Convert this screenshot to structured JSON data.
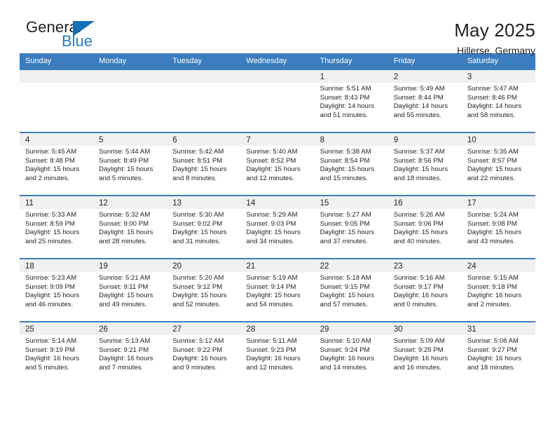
{
  "brand": {
    "name_part1": "General",
    "name_part2": "Blue",
    "triangle_color": "#1470b8",
    "blue_color": "#1f7dc0"
  },
  "header": {
    "title": "May 2025",
    "subtitle": "Hillerse, Germany"
  },
  "theme": {
    "header_row_bg": "#3b7dbf",
    "day_band_bg": "#f0f0f0",
    "text_color": "#231f20"
  },
  "weekdays": [
    "Sunday",
    "Monday",
    "Tuesday",
    "Wednesday",
    "Thursday",
    "Friday",
    "Saturday"
  ],
  "weeks": [
    [
      {
        "day": "",
        "sunrise": "",
        "sunset": "",
        "daylight_line1": "",
        "daylight_line2": ""
      },
      {
        "day": "",
        "sunrise": "",
        "sunset": "",
        "daylight_line1": "",
        "daylight_line2": ""
      },
      {
        "day": "",
        "sunrise": "",
        "sunset": "",
        "daylight_line1": "",
        "daylight_line2": ""
      },
      {
        "day": "",
        "sunrise": "",
        "sunset": "",
        "daylight_line1": "",
        "daylight_line2": ""
      },
      {
        "day": "1",
        "sunrise": "Sunrise: 5:51 AM",
        "sunset": "Sunset: 8:43 PM",
        "daylight_line1": "Daylight: 14 hours",
        "daylight_line2": "and 51 minutes."
      },
      {
        "day": "2",
        "sunrise": "Sunrise: 5:49 AM",
        "sunset": "Sunset: 8:44 PM",
        "daylight_line1": "Daylight: 14 hours",
        "daylight_line2": "and 55 minutes."
      },
      {
        "day": "3",
        "sunrise": "Sunrise: 5:47 AM",
        "sunset": "Sunset: 8:46 PM",
        "daylight_line1": "Daylight: 14 hours",
        "daylight_line2": "and 58 minutes."
      }
    ],
    [
      {
        "day": "4",
        "sunrise": "Sunrise: 5:45 AM",
        "sunset": "Sunset: 8:48 PM",
        "daylight_line1": "Daylight: 15 hours",
        "daylight_line2": "and 2 minutes."
      },
      {
        "day": "5",
        "sunrise": "Sunrise: 5:44 AM",
        "sunset": "Sunset: 8:49 PM",
        "daylight_line1": "Daylight: 15 hours",
        "daylight_line2": "and 5 minutes."
      },
      {
        "day": "6",
        "sunrise": "Sunrise: 5:42 AM",
        "sunset": "Sunset: 8:51 PM",
        "daylight_line1": "Daylight: 15 hours",
        "daylight_line2": "and 8 minutes."
      },
      {
        "day": "7",
        "sunrise": "Sunrise: 5:40 AM",
        "sunset": "Sunset: 8:52 PM",
        "daylight_line1": "Daylight: 15 hours",
        "daylight_line2": "and 12 minutes."
      },
      {
        "day": "8",
        "sunrise": "Sunrise: 5:38 AM",
        "sunset": "Sunset: 8:54 PM",
        "daylight_line1": "Daylight: 15 hours",
        "daylight_line2": "and 15 minutes."
      },
      {
        "day": "9",
        "sunrise": "Sunrise: 5:37 AM",
        "sunset": "Sunset: 8:56 PM",
        "daylight_line1": "Daylight: 15 hours",
        "daylight_line2": "and 18 minutes."
      },
      {
        "day": "10",
        "sunrise": "Sunrise: 5:35 AM",
        "sunset": "Sunset: 8:57 PM",
        "daylight_line1": "Daylight: 15 hours",
        "daylight_line2": "and 22 minutes."
      }
    ],
    [
      {
        "day": "11",
        "sunrise": "Sunrise: 5:33 AM",
        "sunset": "Sunset: 8:59 PM",
        "daylight_line1": "Daylight: 15 hours",
        "daylight_line2": "and 25 minutes."
      },
      {
        "day": "12",
        "sunrise": "Sunrise: 5:32 AM",
        "sunset": "Sunset: 9:00 PM",
        "daylight_line1": "Daylight: 15 hours",
        "daylight_line2": "and 28 minutes."
      },
      {
        "day": "13",
        "sunrise": "Sunrise: 5:30 AM",
        "sunset": "Sunset: 9:02 PM",
        "daylight_line1": "Daylight: 15 hours",
        "daylight_line2": "and 31 minutes."
      },
      {
        "day": "14",
        "sunrise": "Sunrise: 5:29 AM",
        "sunset": "Sunset: 9:03 PM",
        "daylight_line1": "Daylight: 15 hours",
        "daylight_line2": "and 34 minutes."
      },
      {
        "day": "15",
        "sunrise": "Sunrise: 5:27 AM",
        "sunset": "Sunset: 9:05 PM",
        "daylight_line1": "Daylight: 15 hours",
        "daylight_line2": "and 37 minutes."
      },
      {
        "day": "16",
        "sunrise": "Sunrise: 5:26 AM",
        "sunset": "Sunset: 9:06 PM",
        "daylight_line1": "Daylight: 15 hours",
        "daylight_line2": "and 40 minutes."
      },
      {
        "day": "17",
        "sunrise": "Sunrise: 5:24 AM",
        "sunset": "Sunset: 9:08 PM",
        "daylight_line1": "Daylight: 15 hours",
        "daylight_line2": "and 43 minutes."
      }
    ],
    [
      {
        "day": "18",
        "sunrise": "Sunrise: 5:23 AM",
        "sunset": "Sunset: 9:09 PM",
        "daylight_line1": "Daylight: 15 hours",
        "daylight_line2": "and 46 minutes."
      },
      {
        "day": "19",
        "sunrise": "Sunrise: 5:21 AM",
        "sunset": "Sunset: 9:11 PM",
        "daylight_line1": "Daylight: 15 hours",
        "daylight_line2": "and 49 minutes."
      },
      {
        "day": "20",
        "sunrise": "Sunrise: 5:20 AM",
        "sunset": "Sunset: 9:12 PM",
        "daylight_line1": "Daylight: 15 hours",
        "daylight_line2": "and 52 minutes."
      },
      {
        "day": "21",
        "sunrise": "Sunrise: 5:19 AM",
        "sunset": "Sunset: 9:14 PM",
        "daylight_line1": "Daylight: 15 hours",
        "daylight_line2": "and 54 minutes."
      },
      {
        "day": "22",
        "sunrise": "Sunrise: 5:18 AM",
        "sunset": "Sunset: 9:15 PM",
        "daylight_line1": "Daylight: 15 hours",
        "daylight_line2": "and 57 minutes."
      },
      {
        "day": "23",
        "sunrise": "Sunrise: 5:16 AM",
        "sunset": "Sunset: 9:17 PM",
        "daylight_line1": "Daylight: 16 hours",
        "daylight_line2": "and 0 minutes."
      },
      {
        "day": "24",
        "sunrise": "Sunrise: 5:15 AM",
        "sunset": "Sunset: 9:18 PM",
        "daylight_line1": "Daylight: 16 hours",
        "daylight_line2": "and 2 minutes."
      }
    ],
    [
      {
        "day": "25",
        "sunrise": "Sunrise: 5:14 AM",
        "sunset": "Sunset: 9:19 PM",
        "daylight_line1": "Daylight: 16 hours",
        "daylight_line2": "and 5 minutes."
      },
      {
        "day": "26",
        "sunrise": "Sunrise: 5:13 AM",
        "sunset": "Sunset: 9:21 PM",
        "daylight_line1": "Daylight: 16 hours",
        "daylight_line2": "and 7 minutes."
      },
      {
        "day": "27",
        "sunrise": "Sunrise: 5:12 AM",
        "sunset": "Sunset: 9:22 PM",
        "daylight_line1": "Daylight: 16 hours",
        "daylight_line2": "and 9 minutes."
      },
      {
        "day": "28",
        "sunrise": "Sunrise: 5:11 AM",
        "sunset": "Sunset: 9:23 PM",
        "daylight_line1": "Daylight: 16 hours",
        "daylight_line2": "and 12 minutes."
      },
      {
        "day": "29",
        "sunrise": "Sunrise: 5:10 AM",
        "sunset": "Sunset: 9:24 PM",
        "daylight_line1": "Daylight: 16 hours",
        "daylight_line2": "and 14 minutes."
      },
      {
        "day": "30",
        "sunrise": "Sunrise: 5:09 AM",
        "sunset": "Sunset: 9:25 PM",
        "daylight_line1": "Daylight: 16 hours",
        "daylight_line2": "and 16 minutes."
      },
      {
        "day": "31",
        "sunrise": "Sunrise: 5:08 AM",
        "sunset": "Sunset: 9:27 PM",
        "daylight_line1": "Daylight: 16 hours",
        "daylight_line2": "and 18 minutes."
      }
    ]
  ]
}
